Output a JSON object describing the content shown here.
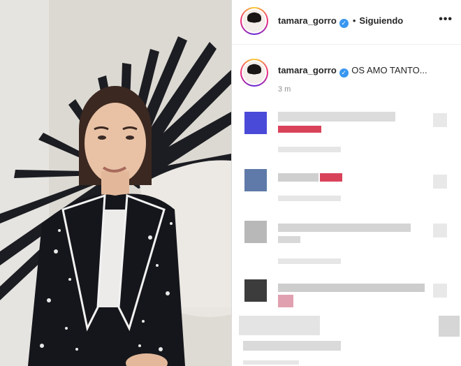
{
  "post": {
    "author": "tamara_gorro",
    "follow_status": "Siguiendo",
    "separator": "•",
    "caption": "OS AMO TANTO...",
    "time_ago": "3 m"
  },
  "icons": {
    "verified": "verified-badge-icon",
    "more": "more-options-icon"
  },
  "comments": [
    {
      "state": "pixelated",
      "accent": "#4a4ad8"
    },
    {
      "state": "pixelated",
      "accent": "#5f7aa8"
    },
    {
      "state": "pixelated",
      "accent": "#b8b8b8"
    },
    {
      "state": "pixelated",
      "accent": "#3c3c3c"
    },
    {
      "state": "pixelated",
      "accent": "#d0d0d0"
    }
  ],
  "colors": {
    "verified": "#3897f0",
    "text": "#262626",
    "muted": "#8e8e8e",
    "border": "#dbdbdb"
  }
}
